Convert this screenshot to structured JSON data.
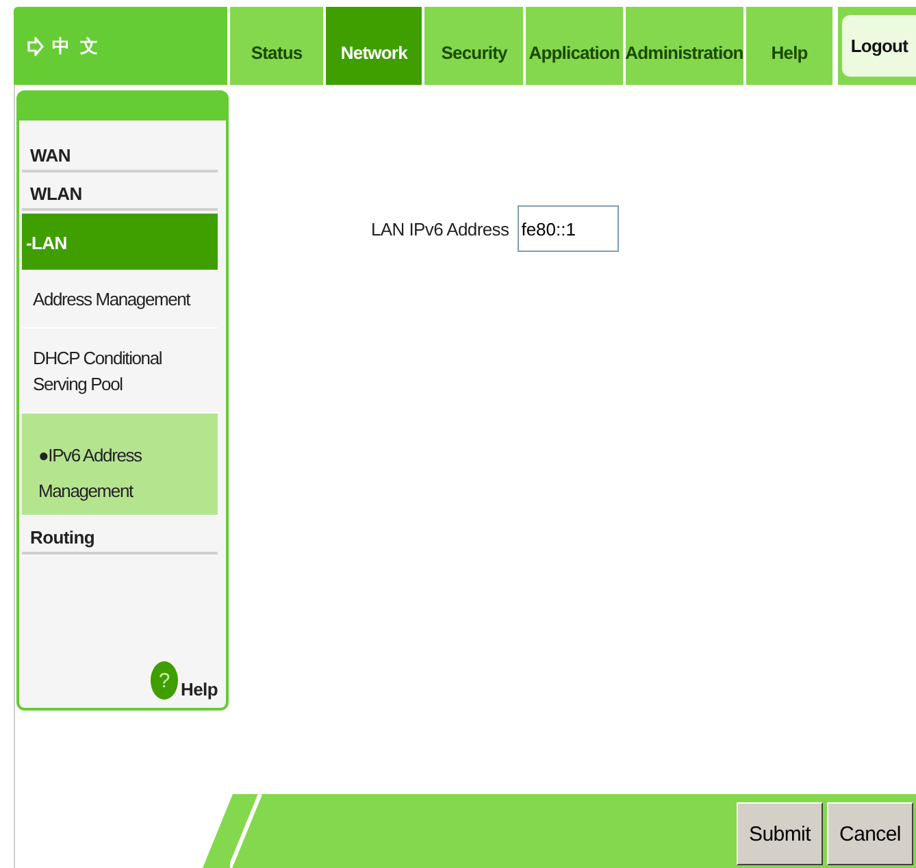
{
  "language": {
    "label": "中 文"
  },
  "nav": [
    {
      "label": "Status",
      "selected": false
    },
    {
      "label": "Network",
      "selected": true
    },
    {
      "label": "Security",
      "selected": false
    },
    {
      "label": "Application",
      "selected": false
    },
    {
      "label": "Administration",
      "selected": false
    },
    {
      "label": "Help",
      "selected": false
    }
  ],
  "logout": {
    "label": "Logout"
  },
  "sidebar": {
    "items": [
      {
        "label": "WAN",
        "selected": false
      },
      {
        "label": "WLAN",
        "selected": false
      },
      {
        "label": "-LAN",
        "selected": true,
        "children": [
          {
            "label": "Address Management",
            "selected": false
          },
          {
            "label": "DHCP Conditional Serving Pool",
            "selected": false
          },
          {
            "label": "●IPv6 Address Management",
            "selected": true
          }
        ]
      },
      {
        "label": "Routing",
        "selected": false
      }
    ],
    "help": {
      "icon": "?",
      "label": "Help"
    }
  },
  "form": {
    "fields": [
      {
        "label": "LAN IPv6 Address",
        "value": "fe80::1"
      }
    ]
  },
  "buttons": [
    "Submit",
    "Cancel"
  ]
}
